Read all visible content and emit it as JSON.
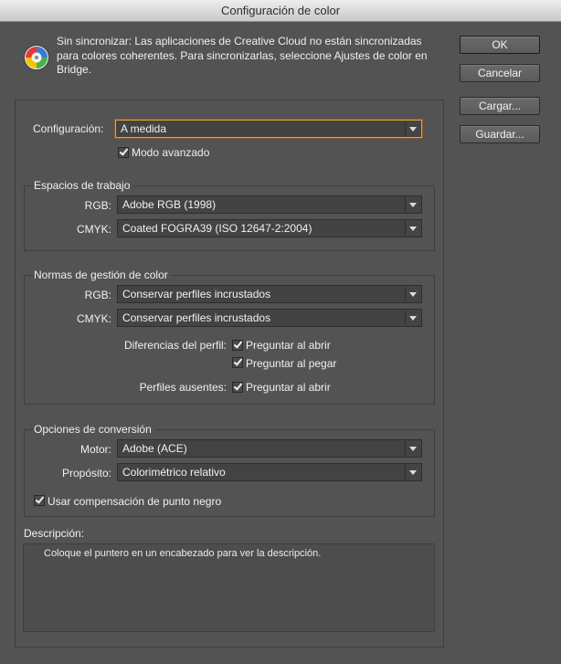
{
  "window": {
    "title": "Configuración de color"
  },
  "sync": {
    "icon": "color-sync-icon",
    "message": "Sin sincronizar: Las aplicaciones de Creative Cloud no están sincronizadas para colores coherentes. Para sincronizarlas, seleccione Ajustes de color en Bridge."
  },
  "buttons": {
    "ok": "OK",
    "cancel": "Cancelar",
    "load": "Cargar...",
    "save": "Guardar..."
  },
  "settings": {
    "label": "Configuración:",
    "value": "A medida",
    "advanced_label": "Modo avanzado"
  },
  "working_spaces": {
    "legend": "Espacios de trabajo",
    "rgb_label": "RGB:",
    "rgb_value": "Adobe RGB (1998)",
    "cmyk_label": "CMYK:",
    "cmyk_value": "Coated FOGRA39 (ISO 12647-2:2004)"
  },
  "policies": {
    "legend": "Normas de gestión de color",
    "rgb_label": "RGB:",
    "rgb_value": "Conservar perfiles incrustados",
    "cmyk_label": "CMYK:",
    "cmyk_value": "Conservar perfiles incrustados",
    "mismatch_label": "Diferencias del perfil:",
    "ask_open": "Preguntar al abrir",
    "ask_paste": "Preguntar al pegar",
    "missing_label": "Perfiles ausentes:",
    "missing_ask_open": "Preguntar al abrir"
  },
  "conversion": {
    "legend": "Opciones de conversión",
    "engine_label": "Motor:",
    "engine_value": "Adobe (ACE)",
    "intent_label": "Propósito:",
    "intent_value": "Colorimétrico relativo",
    "bpc_label": "Usar compensación de punto negro"
  },
  "description": {
    "label": "Descripción:",
    "text": "Coloque el puntero en un encabezado para ver la descripción."
  },
  "colors": {
    "panel": "#535353",
    "field": "#434343",
    "focus": "#f0a030"
  }
}
